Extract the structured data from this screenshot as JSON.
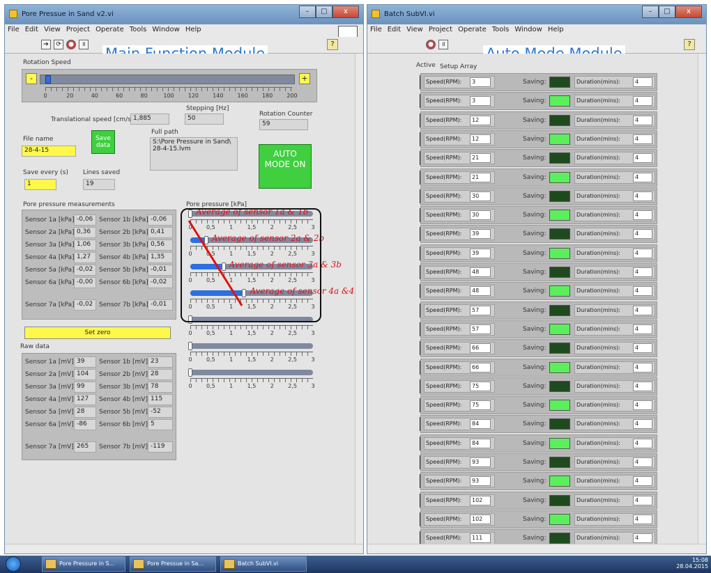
{
  "main_window": {
    "title": "Pore Pressue in Sand v2.vi",
    "menu": [
      "File",
      "Edit",
      "View",
      "Project",
      "Operate",
      "Tools",
      "Window",
      "Help"
    ],
    "annotation": "Main Function Module",
    "rotation_speed": {
      "label": "Rotation Speed",
      "minus": "-",
      "plus": "+",
      "scale": [
        "0",
        "20",
        "40",
        "60",
        "80",
        "100",
        "120",
        "140",
        "160",
        "180",
        "200"
      ],
      "value_fraction": 0.02
    },
    "translational_speed": {
      "label": "Translational speed [cm/s]",
      "value": "1,885"
    },
    "stepping": {
      "label": "Stepping [Hz]",
      "value": "50"
    },
    "rotation_counter": {
      "label": "Rotation Counter",
      "value": "59"
    },
    "file_name": {
      "label": "File name",
      "value": "28-4-15"
    },
    "save_data": "Save data",
    "full_path": {
      "label": "Full path",
      "value": "S:\\Pore Pressure in Sand\\ 28-4-15.lvm"
    },
    "auto_mode": "AUTO MODE ON",
    "save_every": {
      "label": "Save every (s)",
      "value": "1"
    },
    "lines_saved": {
      "label": "Lines saved",
      "value": "19"
    },
    "pore_pressure_measurements": {
      "label": "Pore pressure measurements",
      "rows": [
        {
          "a_label": "Sensor 1a [kPa]",
          "a_value": "-0,06",
          "b_label": "Sensor 1b [kPa]",
          "b_value": "-0,06"
        },
        {
          "a_label": "Sensor 2a [kPa]",
          "a_value": "0,36",
          "b_label": "Sensor 2b [kPa]",
          "b_value": "0,41"
        },
        {
          "a_label": "Sensor 3a [kPa]",
          "a_value": "1,06",
          "b_label": "Sensor 3b [kPa]",
          "b_value": "0,56"
        },
        {
          "a_label": "Sensor 4a [kPa]",
          "a_value": "1,27",
          "b_label": "Sensor 4b [kPa]",
          "b_value": "1,35"
        },
        {
          "a_label": "Sensor 5a [kPa]",
          "a_value": "-0,02",
          "b_label": "Sensor 5b [kPa]",
          "b_value": "-0,01"
        },
        {
          "a_label": "Sensor 6a [kPa]",
          "a_value": "-0,00",
          "b_label": "Sensor 6b [kPa]",
          "b_value": "-0,02"
        },
        {
          "a_label": "Sensor 7a [kPa]",
          "a_value": "-0,02",
          "b_label": "Sensor 7b [kPa]",
          "b_value": "-0,01"
        }
      ]
    },
    "pore_pressure": {
      "label": "Pore pressure [kPa]",
      "scale": [
        "0",
        "0,5",
        "1",
        "1,5",
        "2",
        "2,5",
        "3"
      ],
      "averages": [
        {
          "label": "Average of sensor 1a & 1b",
          "fraction": 0.0
        },
        {
          "label": "Average of sensor 2a & 2b",
          "fraction": 0.13
        },
        {
          "label": "Average of sensor 3a & 3b",
          "fraction": 0.27
        },
        {
          "label": "Average of sensor 4a &4b",
          "fraction": 0.44
        },
        {
          "label": "",
          "fraction": 0.0
        },
        {
          "label": "",
          "fraction": 0.0
        },
        {
          "label": "",
          "fraction": 0.0
        }
      ]
    },
    "set_zero": "Set zero",
    "raw_data": {
      "label": "Raw data",
      "rows": [
        {
          "a_label": "Sensor 1a [mV]",
          "a_value": "39",
          "b_label": "Sensor 1b [mV]",
          "b_value": "23"
        },
        {
          "a_label": "Sensor 2a [mV]",
          "a_value": "104",
          "b_label": "Sensor 2b [mV]",
          "b_value": "28"
        },
        {
          "a_label": "Sensor 3a [mV]",
          "a_value": "99",
          "b_label": "Sensor 3b [mV]",
          "b_value": "78"
        },
        {
          "a_label": "Sensor 4a [mV]",
          "a_value": "127",
          "b_label": "Sensor 4b [mV]",
          "b_value": "115"
        },
        {
          "a_label": "Sensor 5a [mV]",
          "a_value": "28",
          "b_label": "Sensor 5b [mV]",
          "b_value": "-52"
        },
        {
          "a_label": "Sensor 6a [mV]",
          "a_value": "-86",
          "b_label": "Sensor 6b [mV]",
          "b_value": "5"
        },
        {
          "a_label": "Sensor 7a [mV]",
          "a_value": "265",
          "b_label": "Sensor 7b [mV]",
          "b_value": "-119"
        }
      ]
    }
  },
  "batch_window": {
    "title": "Batch SubVI.vi",
    "menu": [
      "File",
      "Edit",
      "View",
      "Project",
      "Operate",
      "Tools",
      "Window",
      "Help"
    ],
    "annotation": "Auto Mode Module",
    "active_label": "Active",
    "setup_label": "Setup Array",
    "speed_label": "Speed(RPM):",
    "saving_label": "Saving:",
    "duration_label": "Duration(mins):",
    "rows": [
      {
        "speed": "3",
        "saving": false,
        "duration": "4",
        "active": true
      },
      {
        "speed": "3",
        "saving": true,
        "duration": "4",
        "active": false
      },
      {
        "speed": "12",
        "saving": false,
        "duration": "4",
        "active": false
      },
      {
        "speed": "12",
        "saving": true,
        "duration": "4",
        "active": false
      },
      {
        "speed": "21",
        "saving": false,
        "duration": "4",
        "active": false
      },
      {
        "speed": "21",
        "saving": true,
        "duration": "4",
        "active": false
      },
      {
        "speed": "30",
        "saving": false,
        "duration": "4",
        "active": false
      },
      {
        "speed": "30",
        "saving": true,
        "duration": "4",
        "active": false
      },
      {
        "speed": "39",
        "saving": false,
        "duration": "4",
        "active": false
      },
      {
        "speed": "39",
        "saving": true,
        "duration": "4",
        "active": false
      },
      {
        "speed": "48",
        "saving": false,
        "duration": "4",
        "active": false
      },
      {
        "speed": "48",
        "saving": true,
        "duration": "4",
        "active": false
      },
      {
        "speed": "57",
        "saving": false,
        "duration": "4",
        "active": false
      },
      {
        "speed": "57",
        "saving": true,
        "duration": "4",
        "active": false
      },
      {
        "speed": "66",
        "saving": false,
        "duration": "4",
        "active": false
      },
      {
        "speed": "66",
        "saving": true,
        "duration": "4",
        "active": false
      },
      {
        "speed": "75",
        "saving": false,
        "duration": "4",
        "active": false
      },
      {
        "speed": "75",
        "saving": true,
        "duration": "4",
        "active": false
      },
      {
        "speed": "84",
        "saving": false,
        "duration": "4",
        "active": false
      },
      {
        "speed": "84",
        "saving": true,
        "duration": "4",
        "active": false
      },
      {
        "speed": "93",
        "saving": false,
        "duration": "4",
        "active": false
      },
      {
        "speed": "93",
        "saving": true,
        "duration": "4",
        "active": false
      },
      {
        "speed": "102",
        "saving": false,
        "duration": "4",
        "active": false
      },
      {
        "speed": "102",
        "saving": true,
        "duration": "4",
        "active": false
      },
      {
        "speed": "111",
        "saving": false,
        "duration": "4",
        "active": false
      }
    ]
  },
  "taskbar": {
    "items": [
      "Pore Pressure in S...",
      "Pore Pressue in Sa...",
      "Batch SubVI.vi"
    ],
    "time": "15:08",
    "date": "28.04.2015"
  },
  "colors": {
    "led_on": "#f01818",
    "led_off": "#4a1010",
    "saving_on": "#5bf05b",
    "saving_off": "#1f4a1f",
    "annotation": "#2a78d4",
    "average_text": "#e01010"
  }
}
